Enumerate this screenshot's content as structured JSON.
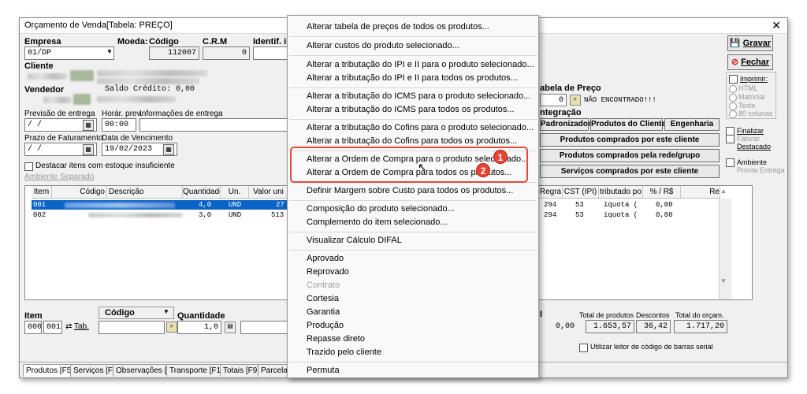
{
  "window": {
    "title": "Orçamento de Venda[Tabela: PREÇO]",
    "close": "✕"
  },
  "header": {
    "empresa_label": "Empresa",
    "empresa_value": "01/DP",
    "moeda_label": "Moeda:",
    "codigo_label": "Código",
    "codigo_value": "112007",
    "crm_label": "C.R.M",
    "crm_value": "0",
    "identif_label": "Identif. int",
    "cliente_label": "Cliente",
    "vendedor_label": "Vendedor",
    "saldo_credito": "Saldo Crédito: 0,00",
    "previsao_label": "Previsão de entrega",
    "previsao_value": " /  /",
    "horar_label": "Horár. prev.",
    "horar_value": "00:00",
    "informacoes_label": "Informações de entrega",
    "prazo_label": "Prazo de Faturamento",
    "prazo_value": " /  /",
    "vencimento_label": "Data de Vencimento",
    "vencimento_value": "19/02/2023",
    "destacar_label": "Destacar itens com estoque insuficiente",
    "ambiente_link": "Ambiente Separado"
  },
  "right_panel": {
    "gravar": "Gravar",
    "fechar": "Fechar",
    "imprimir": "Imprimir:",
    "print_options": [
      "HTML",
      "Matricial",
      "Texto",
      "80 colunas"
    ],
    "tabela_preco_label": "abela de Preço",
    "tabela_preco_value": "0",
    "nao_encontrado": "NÃO ENCONTRADO!!!",
    "integracao": "ntegração",
    "padronizados": "Padronizados",
    "produtos_cliente": "Produtos do Cliente",
    "engenharia": "Engenharia",
    "comprados_cliente": "Produtos comprados por este cliente",
    "comprados_rede": "Produtos comprados pela rede/grupo",
    "servicos_cliente": "Serviços comprados por este cliente",
    "finalizar": "Finalizar",
    "faturar": "Faturar",
    "destacado": "Destacado",
    "ambiente": "Ambiente",
    "pronta_entrega": "Pronta Entrega"
  },
  "grid": {
    "columns": [
      "Item",
      "Código",
      "Descrição",
      "Quantidade",
      "Un.",
      "Valor uni"
    ],
    "right_columns": [
      "Regra",
      "CST (IPI)",
      "tributado po",
      "% / R$",
      "Re"
    ],
    "rows": [
      {
        "item": "001",
        "qtd": "4,0",
        "un": "UND",
        "valor": "27",
        "regra": "294",
        "cst": "53",
        "trib": "iquota (",
        "pct": "0,00"
      },
      {
        "item": "002",
        "qtd": "3,0",
        "un": "UND",
        "valor": "513",
        "regra": "294",
        "cst": "53",
        "trib": "iquota (",
        "pct": "0,00"
      }
    ]
  },
  "bottom": {
    "item_label": "Item",
    "codigo_label": "Código",
    "quantidade_label": "Quantidade",
    "item_value": "000",
    "item_value2": "001",
    "tab_label": "Tab.",
    "quantidade_value": "1,0",
    "i_label": "I",
    "total_produtos_label": "Total de produtos",
    "descontos_label": "Descontos",
    "total_orcam_label": "Total do orçam.",
    "zero_value": "0,00",
    "total_produtos": "1.653,57",
    "descontos": "36,42",
    "total_orcam": "1.717,20",
    "leitor_label": "Utilizar leitor de código de barras serial"
  },
  "tabs": [
    "Produtos [F5]",
    "Serviços [F6]",
    "Observações [F7]",
    "Transporte [F10]",
    "Totais [F9]",
    "Parcelas"
  ],
  "menu": {
    "items": [
      "Alterar tabela de preços de todos os produtos...",
      "Alterar custos do produto selecionado...",
      "Alterar a tributação do IPI e II para o produto selecionado...",
      "Alterar a tributação do IPI e II para todos os produtos...",
      "Alterar a tributação do ICMS para o produto selecionado...",
      "Alterar a tributação do ICMS para todos os produtos...",
      "Alterar a tributação do Cofins para o produto selecionado...",
      "Alterar a tributação do Cofins para todos os produtos...",
      "Alterar a Ordem de Compra para o produto selecionado...",
      "Alterar a Ordem de Compra para todos os produtos...",
      "Definir Margem sobre Custo para todos os produtos...",
      "Composição do produto selecionado...",
      "Complemento do item selecionado...",
      "Visualizar Cálculo DIFAL",
      "Aprovado",
      "Reprovado",
      "Contrato",
      "Cortesia",
      "Garantia",
      "Produção",
      "Repasse direto",
      "Trazido pelo cliente",
      "Permuta"
    ],
    "badges": [
      "1",
      "2"
    ]
  }
}
